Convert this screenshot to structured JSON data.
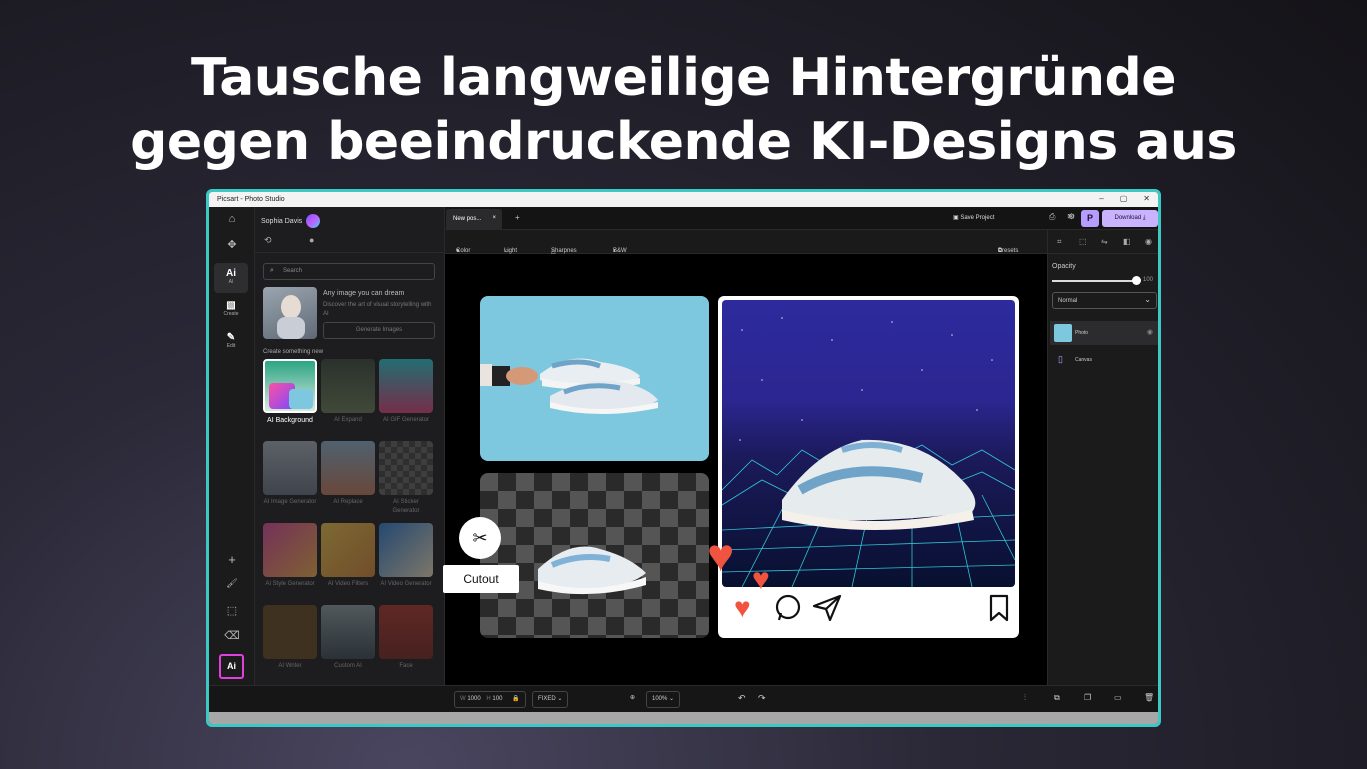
{
  "headline": {
    "line1": "Tausche langweilige Hintergründe",
    "line2": "gegen beeindruckende KI-Designs aus"
  },
  "window": {
    "title": "Picsart - Photo Studio",
    "min": "–",
    "max": "▢",
    "close": "✕"
  },
  "rail": {
    "home": "⌂",
    "move": "✥",
    "tabs": [
      {
        "glyph": "Ai",
        "label": "AI"
      },
      {
        "glyph": "▧",
        "label": "Create"
      },
      {
        "glyph": "✎",
        "label": "Edit"
      }
    ],
    "tools": {
      "plus": "+",
      "brush": "🖌",
      "select": "⬚",
      "eraser": "⌫"
    },
    "ai_button": "Ai"
  },
  "panel": {
    "user_name": "Sophia Davis",
    "search_placeholder": "Search",
    "promo_title": "Any image you can dream",
    "promo_desc": "Discover the art of visual storytelling with AI",
    "generate_button": "Generate Images",
    "section_label": "Create something new",
    "tools": [
      {
        "label": "AI Background"
      },
      {
        "label": "AI Expand"
      },
      {
        "label": "AI GIF Generator"
      },
      {
        "label": "AI Image Generator"
      },
      {
        "label": "AI Replace"
      },
      {
        "label": "AI Sticker Generator"
      },
      {
        "label": "AI Style Generator"
      },
      {
        "label": "AI Video Filters"
      },
      {
        "label": "AI Video Generator"
      },
      {
        "label": "AI Writer"
      },
      {
        "label": "Custom AI"
      },
      {
        "label": "Face"
      }
    ]
  },
  "topbar": {
    "doc_tab": "New pos...",
    "doc_tab_close": "×",
    "add_tab": "+",
    "save_project": "Save Project",
    "p_button": "P",
    "download": "Download"
  },
  "adjust": {
    "color": "Color",
    "light": "Light",
    "sharpness": "Sharpnes",
    "bw": "B&W",
    "presets": "Presets"
  },
  "canvas": {
    "cutout_label": "Cutout",
    "scissors": "✂"
  },
  "props": {
    "opacity_label": "Opacity",
    "opacity_value": "100",
    "opacity_fraction": 1.0,
    "blend_mode": "Normal",
    "layers": [
      {
        "name": "Photo"
      },
      {
        "name": "Canvas"
      }
    ]
  },
  "bottom": {
    "w_label": "W",
    "w_value": "1000",
    "h_label": "H",
    "h_value": "100",
    "fixed": "FIXED",
    "zoom": "100%"
  },
  "colors": {
    "accent": "#3cc9c4",
    "download": "#c9b3ff",
    "heart": "#f0533f",
    "ai_border": "#e040e0"
  }
}
